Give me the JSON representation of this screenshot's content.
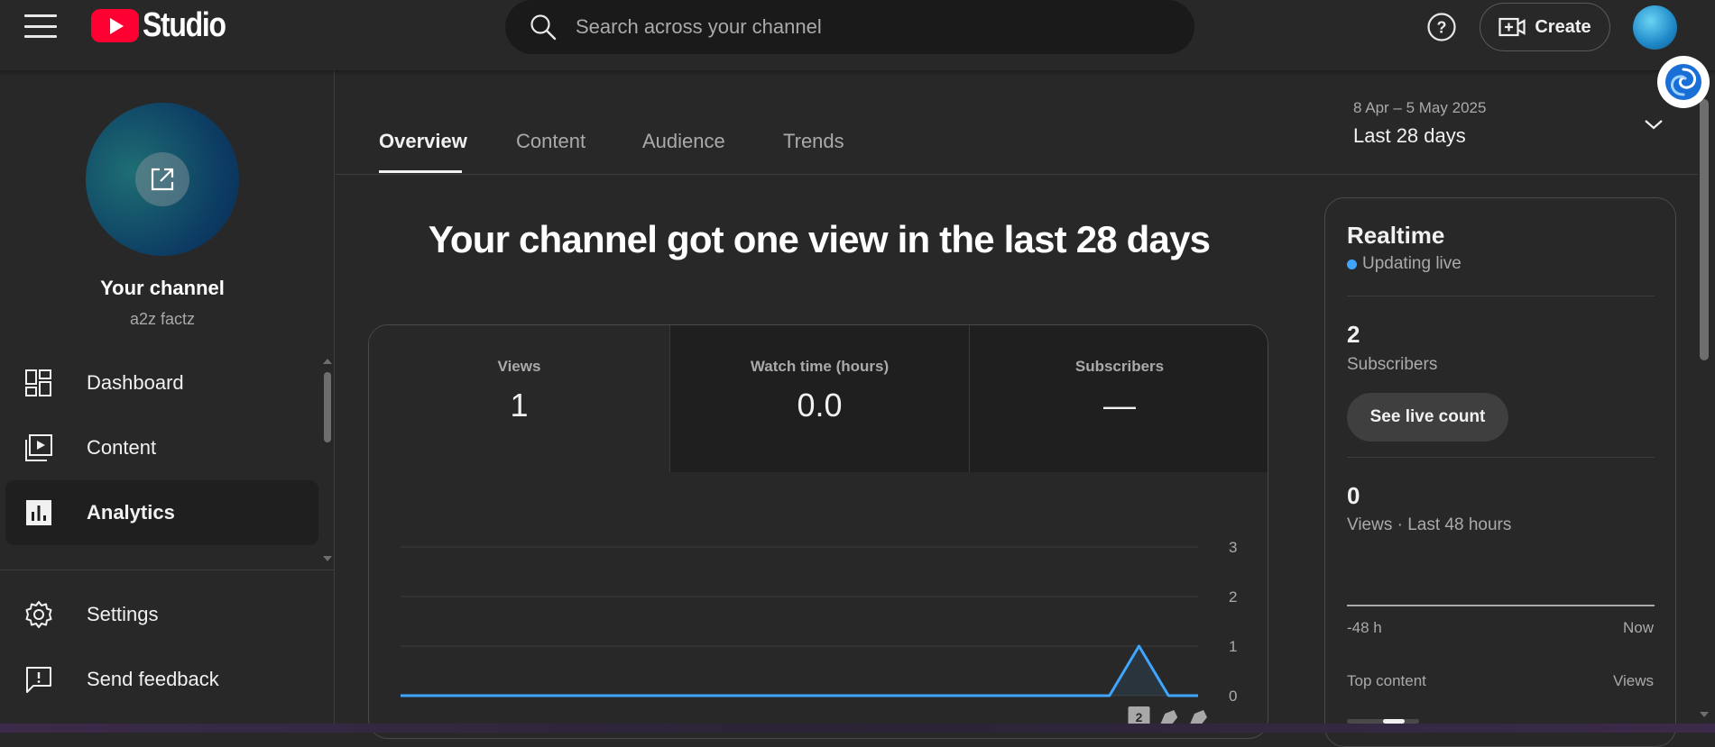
{
  "header": {
    "logo_text": "Studio",
    "search_placeholder": "Search across your channel",
    "create_label": "Create"
  },
  "sidebar": {
    "channel_title": "Your channel",
    "channel_handle": "a2z factz",
    "items": [
      {
        "label": "Dashboard",
        "icon": "dashboard-icon"
      },
      {
        "label": "Content",
        "icon": "content-icon"
      },
      {
        "label": "Analytics",
        "icon": "analytics-icon",
        "active": true
      },
      {
        "label": "Settings",
        "icon": "gear-icon"
      },
      {
        "label": "Send feedback",
        "icon": "feedback-icon"
      }
    ]
  },
  "tabs": [
    {
      "label": "Overview",
      "active": true
    },
    {
      "label": "Content"
    },
    {
      "label": "Audience"
    },
    {
      "label": "Trends"
    }
  ],
  "date_range": {
    "dates": "8 Apr – 5 May 2025",
    "label": "Last 28 days"
  },
  "headline": "Your channel got one view in the last 28 days",
  "metrics": [
    {
      "label": "Views",
      "value": "1"
    },
    {
      "label": "Watch time (hours)",
      "value": "0.0"
    },
    {
      "label": "Subscribers",
      "value": "—"
    }
  ],
  "chart_data": {
    "type": "line",
    "series": [
      {
        "values": [
          0,
          0,
          0,
          0,
          0,
          0,
          0,
          0,
          0,
          0,
          0,
          0,
          0,
          0,
          0,
          0,
          0,
          0,
          0,
          0,
          0,
          0,
          0,
          0,
          0,
          1,
          0,
          0
        ]
      }
    ],
    "y_ticks": [
      "3",
      "2",
      "1",
      "0"
    ],
    "ylim": [
      0,
      3
    ],
    "marker_label": "2",
    "line_color": "#3ea6ff"
  },
  "realtime": {
    "title": "Realtime",
    "status": "Updating live",
    "subscribers_count": "2",
    "subscribers_label": "Subscribers",
    "see_live_label": "See live count",
    "views_count": "0",
    "views_label": "Views · Last 48 hours",
    "axis_start": "-48 h",
    "axis_end": "Now",
    "top_content_label": "Top content",
    "top_content_col": "Views"
  },
  "colors": {
    "accent": "#3ea6ff",
    "brand": "#ff0033",
    "background": "#282828"
  }
}
